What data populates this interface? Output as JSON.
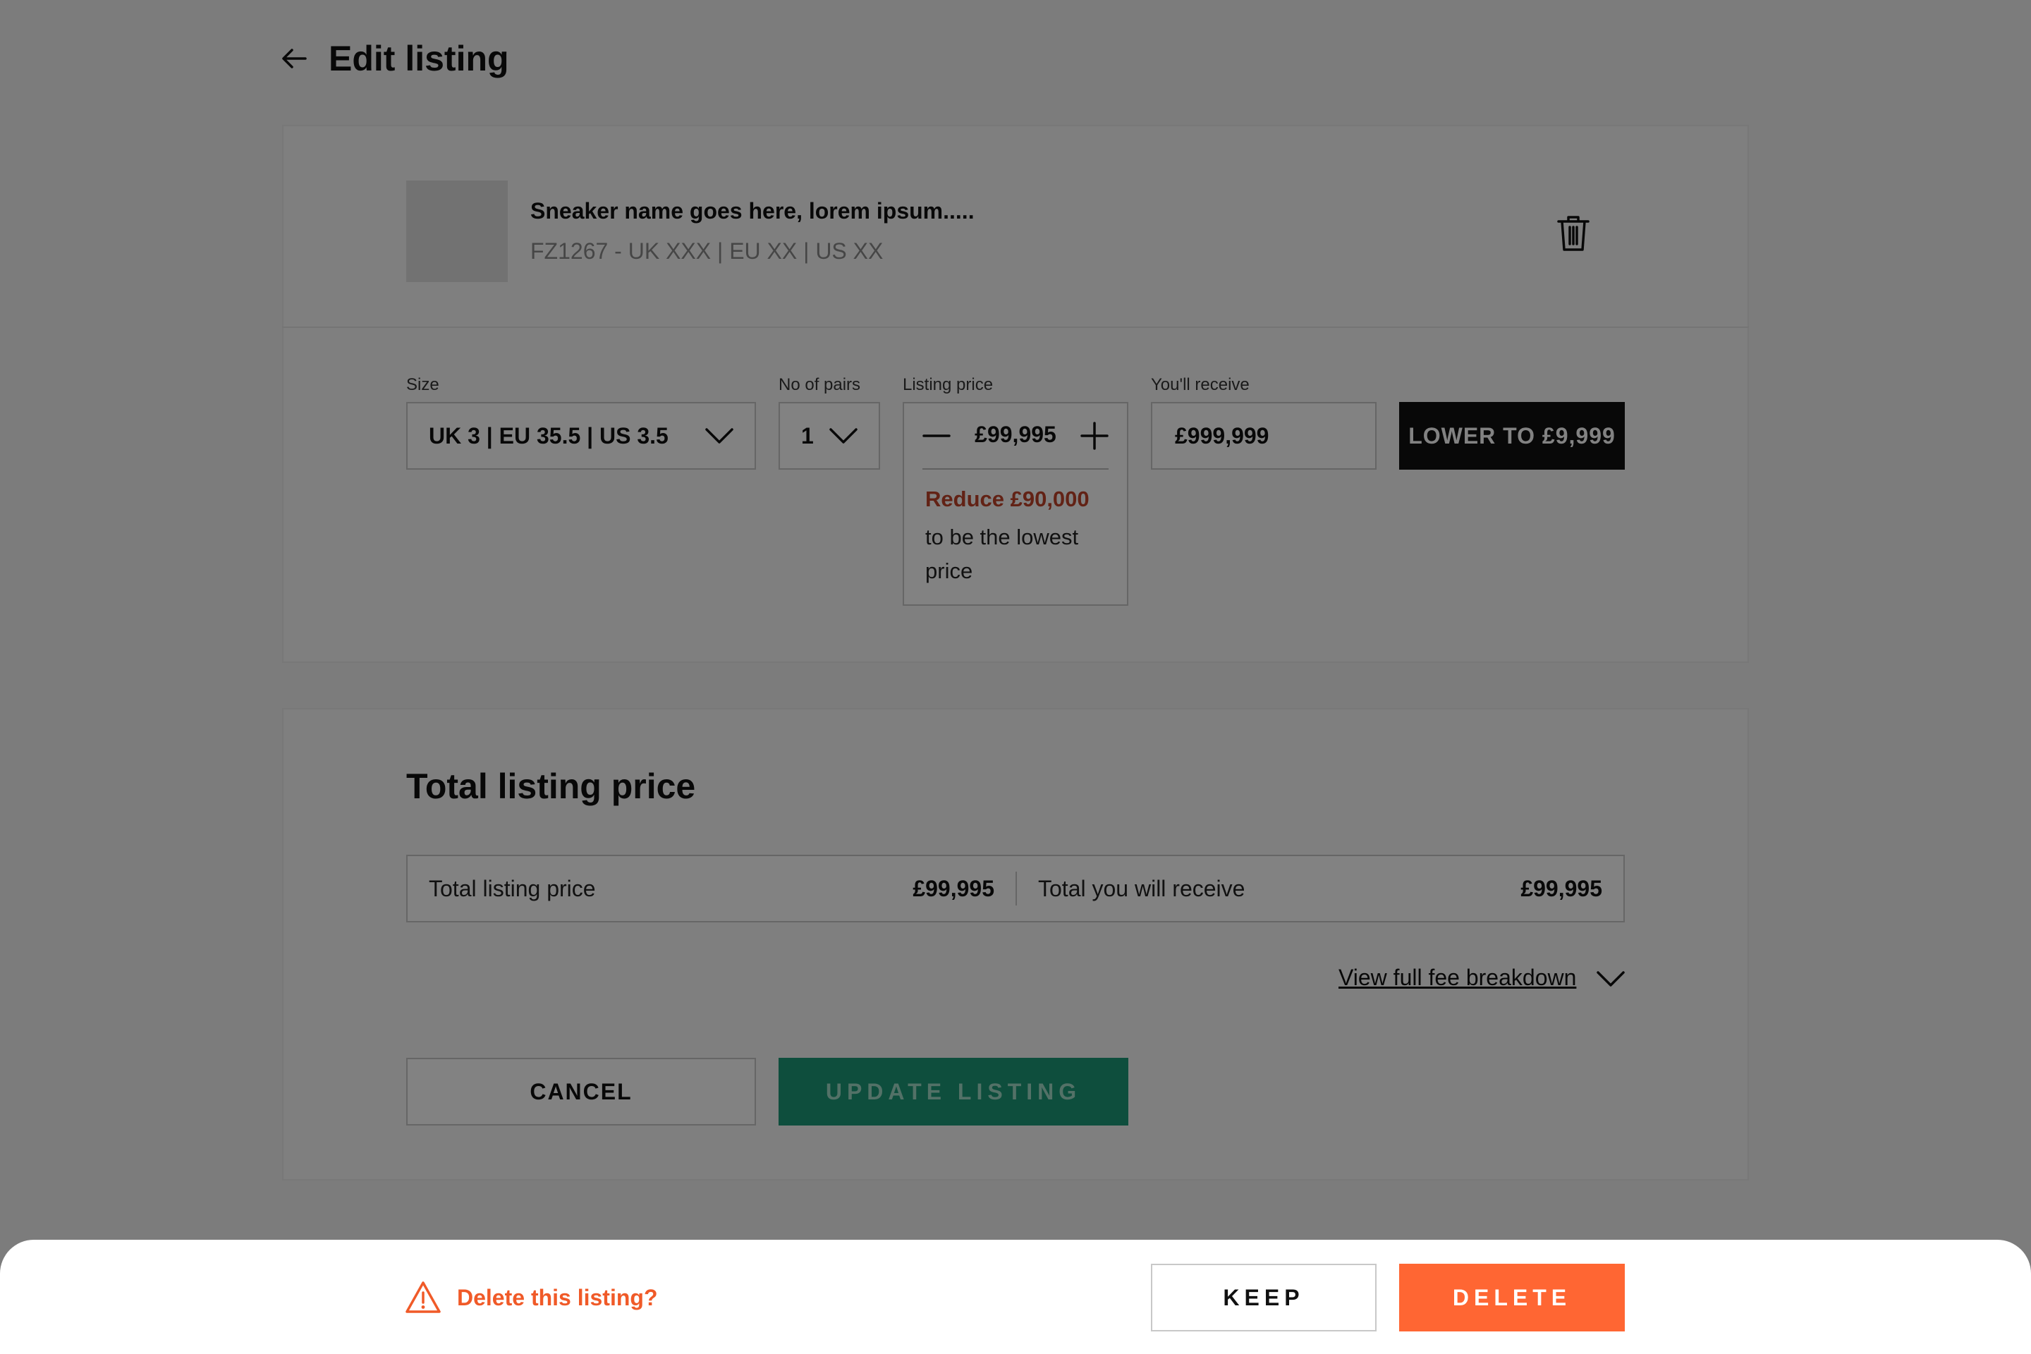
{
  "header": {
    "title": "Edit listing",
    "back_icon": "arrow-left-icon"
  },
  "product": {
    "name": "Sneaker name goes here, lorem ipsum.....",
    "meta": "FZ1267 - UK XXX | EU XX | US XX",
    "delete_icon": "trash-icon"
  },
  "fields": {
    "size_label": "Size",
    "size_value": "UK 3 | EU 35.5 | US 3.5",
    "pairs_label": "No of pairs",
    "pairs_value": "1",
    "price_label": "Listing price",
    "price_value": "£99,995",
    "receive_label": "You'll receive",
    "receive_value": "£999,999",
    "lower_button": "LOWER TO £9,999",
    "reduce_highlight": "Reduce £90,000",
    "reduce_text": "to be the lowest price"
  },
  "totals": {
    "title": "Total listing price",
    "listing_label": "Total listing price",
    "listing_value": "£99,995",
    "receive_label": "Total you will receive",
    "receive_value": "£99,995",
    "fee_link": "View full fee breakdown"
  },
  "actions": {
    "cancel": "CANCEL",
    "update": "UPDATE LISTING"
  },
  "sheet": {
    "message": "Delete this listing?",
    "warning_icon": "warning-triangle-icon",
    "keep": "KEEP",
    "delete": "DELETE"
  },
  "colors": {
    "accent_green": "#1c9a78",
    "delete_orange": "#ff6633",
    "warning_text": "#f05a28",
    "reduce_red": "#c0432a"
  }
}
